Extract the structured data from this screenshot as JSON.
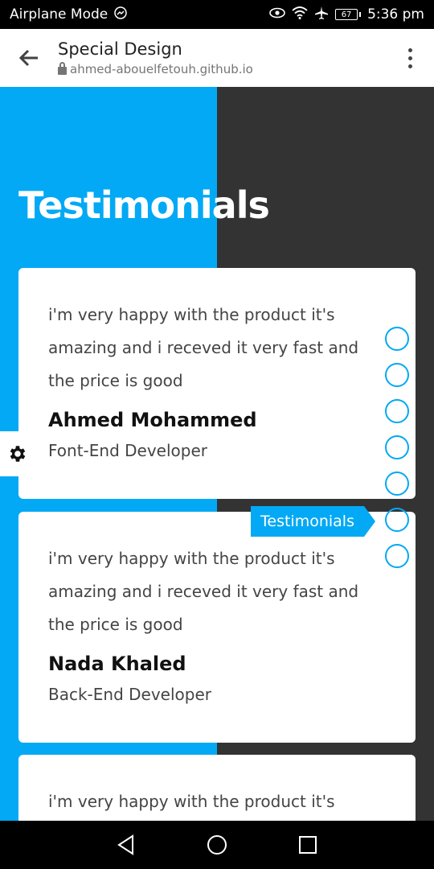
{
  "status_bar": {
    "left_text": "Airplane Mode",
    "battery": "67",
    "time": "5:36 pm"
  },
  "browser": {
    "title": "Special Design",
    "url": "ahmed-abouelfetouh.github.io"
  },
  "section": {
    "title": "Testimonials"
  },
  "testimonials": [
    {
      "quote": "i'm very happy with the product it's amazing and i receved it very fast and the price is good",
      "name": "Ahmed Mohammed",
      "role": "Font-End Developer"
    },
    {
      "quote": "i'm very happy with the product it's amazing and i receved it very fast and the price is good",
      "name": "Nada Khaled",
      "role": "Back-End Developer"
    },
    {
      "quote": "i'm very happy with the product it's"
    }
  ],
  "nav_bullets": {
    "active_tooltip": "Testimonials"
  },
  "colors": {
    "accent": "#03a9f4",
    "dark": "#333333"
  }
}
